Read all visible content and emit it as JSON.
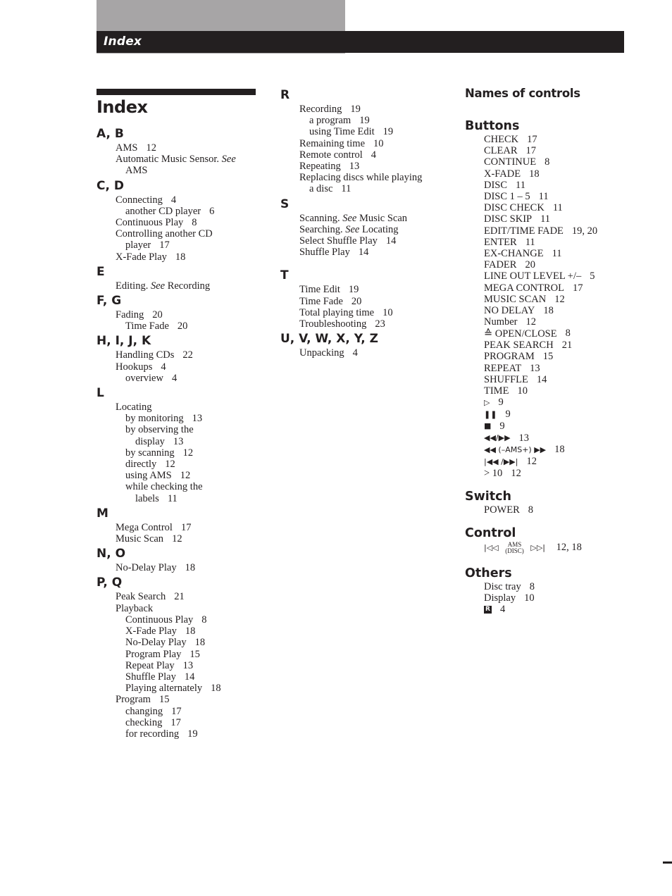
{
  "header": {
    "section_label": "Index"
  },
  "page_title": "Index",
  "columns": {
    "col1": [
      {
        "letter": "A, B",
        "entries": [
          {
            "level": 1,
            "text": "AMS",
            "pages": "12"
          },
          {
            "level": 1,
            "text": "Automatic Music Sensor.",
            "see": "See",
            "target": ""
          },
          {
            "level": 2,
            "text": "AMS",
            "pages": ""
          }
        ]
      },
      {
        "letter": "C, D",
        "entries": [
          {
            "level": 1,
            "text": "Connecting",
            "pages": "4"
          },
          {
            "level": 2,
            "text": "another CD player",
            "pages": "6"
          },
          {
            "level": 1,
            "text": "Continuous Play",
            "pages": "8"
          },
          {
            "level": 1,
            "text": "Controlling another CD",
            "pages": ""
          },
          {
            "level": 2,
            "text": "player",
            "pages": "17"
          },
          {
            "level": 1,
            "text": "X-Fade Play",
            "pages": "18"
          }
        ]
      },
      {
        "letter": "E",
        "entries": [
          {
            "level": 1,
            "text": "Editing.",
            "see": "See",
            "target": "Recording"
          }
        ]
      },
      {
        "letter": "F, G",
        "entries": [
          {
            "level": 1,
            "text": "Fading",
            "pages": "20"
          },
          {
            "level": 2,
            "text": "Time Fade",
            "pages": "20"
          }
        ]
      },
      {
        "letter": "H, I, J, K",
        "entries": [
          {
            "level": 1,
            "text": "Handling CDs",
            "pages": "22"
          },
          {
            "level": 1,
            "text": "Hookups",
            "pages": "4"
          },
          {
            "level": 2,
            "text": "overview",
            "pages": "4"
          }
        ]
      },
      {
        "letter": "L",
        "entries": [
          {
            "level": 1,
            "text": "Locating",
            "pages": ""
          },
          {
            "level": 2,
            "text": "by monitoring",
            "pages": "13"
          },
          {
            "level": 2,
            "text": "by observing the",
            "pages": ""
          },
          {
            "level": 3,
            "text": "display",
            "pages": "13"
          },
          {
            "level": 2,
            "text": "by scanning",
            "pages": "12"
          },
          {
            "level": 2,
            "text": "directly",
            "pages": "12"
          },
          {
            "level": 2,
            "text": "using AMS",
            "pages": "12"
          },
          {
            "level": 2,
            "text": "while checking the",
            "pages": ""
          },
          {
            "level": 3,
            "text": "labels",
            "pages": "11"
          }
        ]
      },
      {
        "letter": "M",
        "entries": [
          {
            "level": 1,
            "text": "Mega Control",
            "pages": "17"
          },
          {
            "level": 1,
            "text": "Music Scan",
            "pages": "12"
          }
        ]
      },
      {
        "letter": "N, O",
        "entries": [
          {
            "level": 1,
            "text": "No-Delay Play",
            "pages": "18"
          }
        ]
      },
      {
        "letter": "P, Q",
        "entries": [
          {
            "level": 1,
            "text": "Peak Search",
            "pages": "21"
          },
          {
            "level": 1,
            "text": "Playback",
            "pages": ""
          },
          {
            "level": 2,
            "text": "Continuous Play",
            "pages": "8"
          },
          {
            "level": 2,
            "text": "X-Fade Play",
            "pages": "18"
          },
          {
            "level": 2,
            "text": "No-Delay Play",
            "pages": "18"
          },
          {
            "level": 2,
            "text": "Program Play",
            "pages": "15"
          },
          {
            "level": 2,
            "text": "Repeat Play",
            "pages": "13"
          },
          {
            "level": 2,
            "text": "Shuffle Play",
            "pages": "14"
          },
          {
            "level": 2,
            "text": "Playing alternately",
            "pages": "18"
          },
          {
            "level": 1,
            "text": "Program",
            "pages": "15"
          },
          {
            "level": 2,
            "text": "changing",
            "pages": "17"
          },
          {
            "level": 2,
            "text": "checking",
            "pages": "17"
          },
          {
            "level": 2,
            "text": "for recording",
            "pages": "19"
          }
        ]
      }
    ],
    "col2": [
      {
        "letter": "R",
        "entries": [
          {
            "level": 1,
            "text": "Recording",
            "pages": "19"
          },
          {
            "level": 2,
            "text": "a program",
            "pages": "19"
          },
          {
            "level": 2,
            "text": "using Time Edit",
            "pages": "19"
          },
          {
            "level": 1,
            "text": "Remaining time",
            "pages": "10"
          },
          {
            "level": 1,
            "text": "Remote control",
            "pages": "4"
          },
          {
            "level": 1,
            "text": "Repeating",
            "pages": "13"
          },
          {
            "level": 1,
            "text": "Replacing discs while playing",
            "pages": ""
          },
          {
            "level": 2,
            "text": "a disc",
            "pages": "11"
          }
        ]
      },
      {
        "letter": "S",
        "entries": [
          {
            "level": 1,
            "text": "Scanning.",
            "see": "See",
            "target": "Music Scan"
          },
          {
            "level": 1,
            "text": "Searching.",
            "see": "See",
            "target": "Locating"
          },
          {
            "level": 1,
            "text": "Select Shuffle Play",
            "pages": "14"
          },
          {
            "level": 1,
            "text": "Shuffle Play",
            "pages": "14"
          }
        ]
      },
      {
        "letter": "T",
        "entries": [
          {
            "level": 1,
            "text": "Time Edit",
            "pages": "19"
          },
          {
            "level": 1,
            "text": "Time Fade",
            "pages": "20"
          },
          {
            "level": 1,
            "text": "Total playing time",
            "pages": "10"
          },
          {
            "level": 1,
            "text": "Troubleshooting",
            "pages": "23"
          }
        ]
      },
      {
        "letter": "U, V, W, X, Y, Z",
        "entries": [
          {
            "level": 1,
            "text": "Unpacking",
            "pages": "4"
          }
        ]
      }
    ]
  },
  "names_of_controls": {
    "title": "Names of controls",
    "buttons": {
      "heading": "Buttons",
      "items": [
        {
          "text": "CHECK",
          "pages": "17"
        },
        {
          "text": "CLEAR",
          "pages": "17"
        },
        {
          "text": "CONTINUE",
          "pages": "8"
        },
        {
          "text": "X-FADE",
          "pages": "18"
        },
        {
          "text": "DISC",
          "pages": "11"
        },
        {
          "text": "DISC 1 – 5",
          "pages": "11"
        },
        {
          "text": "DISC CHECK",
          "pages": "11"
        },
        {
          "text": "DISC SKIP",
          "pages": "11"
        },
        {
          "text": "EDIT/TIME FADE",
          "pages": "19, 20"
        },
        {
          "text": "ENTER",
          "pages": "11"
        },
        {
          "text": "EX-CHANGE",
          "pages": "11"
        },
        {
          "text": "FADER",
          "pages": "20"
        },
        {
          "text": "LINE OUT LEVEL +/–",
          "pages": "5"
        },
        {
          "text": "MEGA CONTROL",
          "pages": "17"
        },
        {
          "text": "MUSIC SCAN",
          "pages": "12"
        },
        {
          "text": "NO DELAY",
          "pages": "18"
        },
        {
          "text": "Number",
          "pages": "12"
        },
        {
          "text": "≙ OPEN/CLOSE",
          "pages": "8",
          "icon": "eject-icon"
        },
        {
          "text": "PEAK SEARCH",
          "pages": "21"
        },
        {
          "text": "PROGRAM",
          "pages": "15"
        },
        {
          "text": "REPEAT",
          "pages": "13"
        },
        {
          "text": "SHUFFLE",
          "pages": "14"
        },
        {
          "text": "TIME",
          "pages": "10"
        },
        {
          "text": "▷",
          "pages": "9",
          "icon": "play-icon"
        },
        {
          "text": "❚❚",
          "pages": "9",
          "icon": "pause-icon"
        },
        {
          "text": "■",
          "pages": "9",
          "icon": "stop-icon"
        },
        {
          "text": "◀◀/▶▶",
          "pages": "13",
          "icon": "rewind-fastforward-icon"
        },
        {
          "text": "◀◀ (–AMS+) ▶▶",
          "pages": "18",
          "icon": "ams-rewind-fastforward-icon"
        },
        {
          "text": "|◀◀ /▶▶|",
          "pages": "12",
          "icon": "skip-prev-next-icon"
        },
        {
          "text": "> 10",
          "pages": "12"
        }
      ]
    },
    "switch": {
      "heading": "Switch",
      "items": [
        {
          "text": "POWER",
          "pages": "8"
        }
      ]
    },
    "control": {
      "heading": "Control",
      "items": [
        {
          "left": "|◁◁",
          "label_top": "AMS",
          "label_bottom": "(DISC)",
          "right": "▷▷|",
          "pages": "12, 18"
        }
      ]
    },
    "others": {
      "heading": "Others",
      "items": [
        {
          "text": "Disc tray",
          "pages": "8"
        },
        {
          "text": "Display",
          "pages": "10"
        },
        {
          "text": "R",
          "pages": "4",
          "icon": "remote-sensor-icon"
        }
      ]
    }
  }
}
